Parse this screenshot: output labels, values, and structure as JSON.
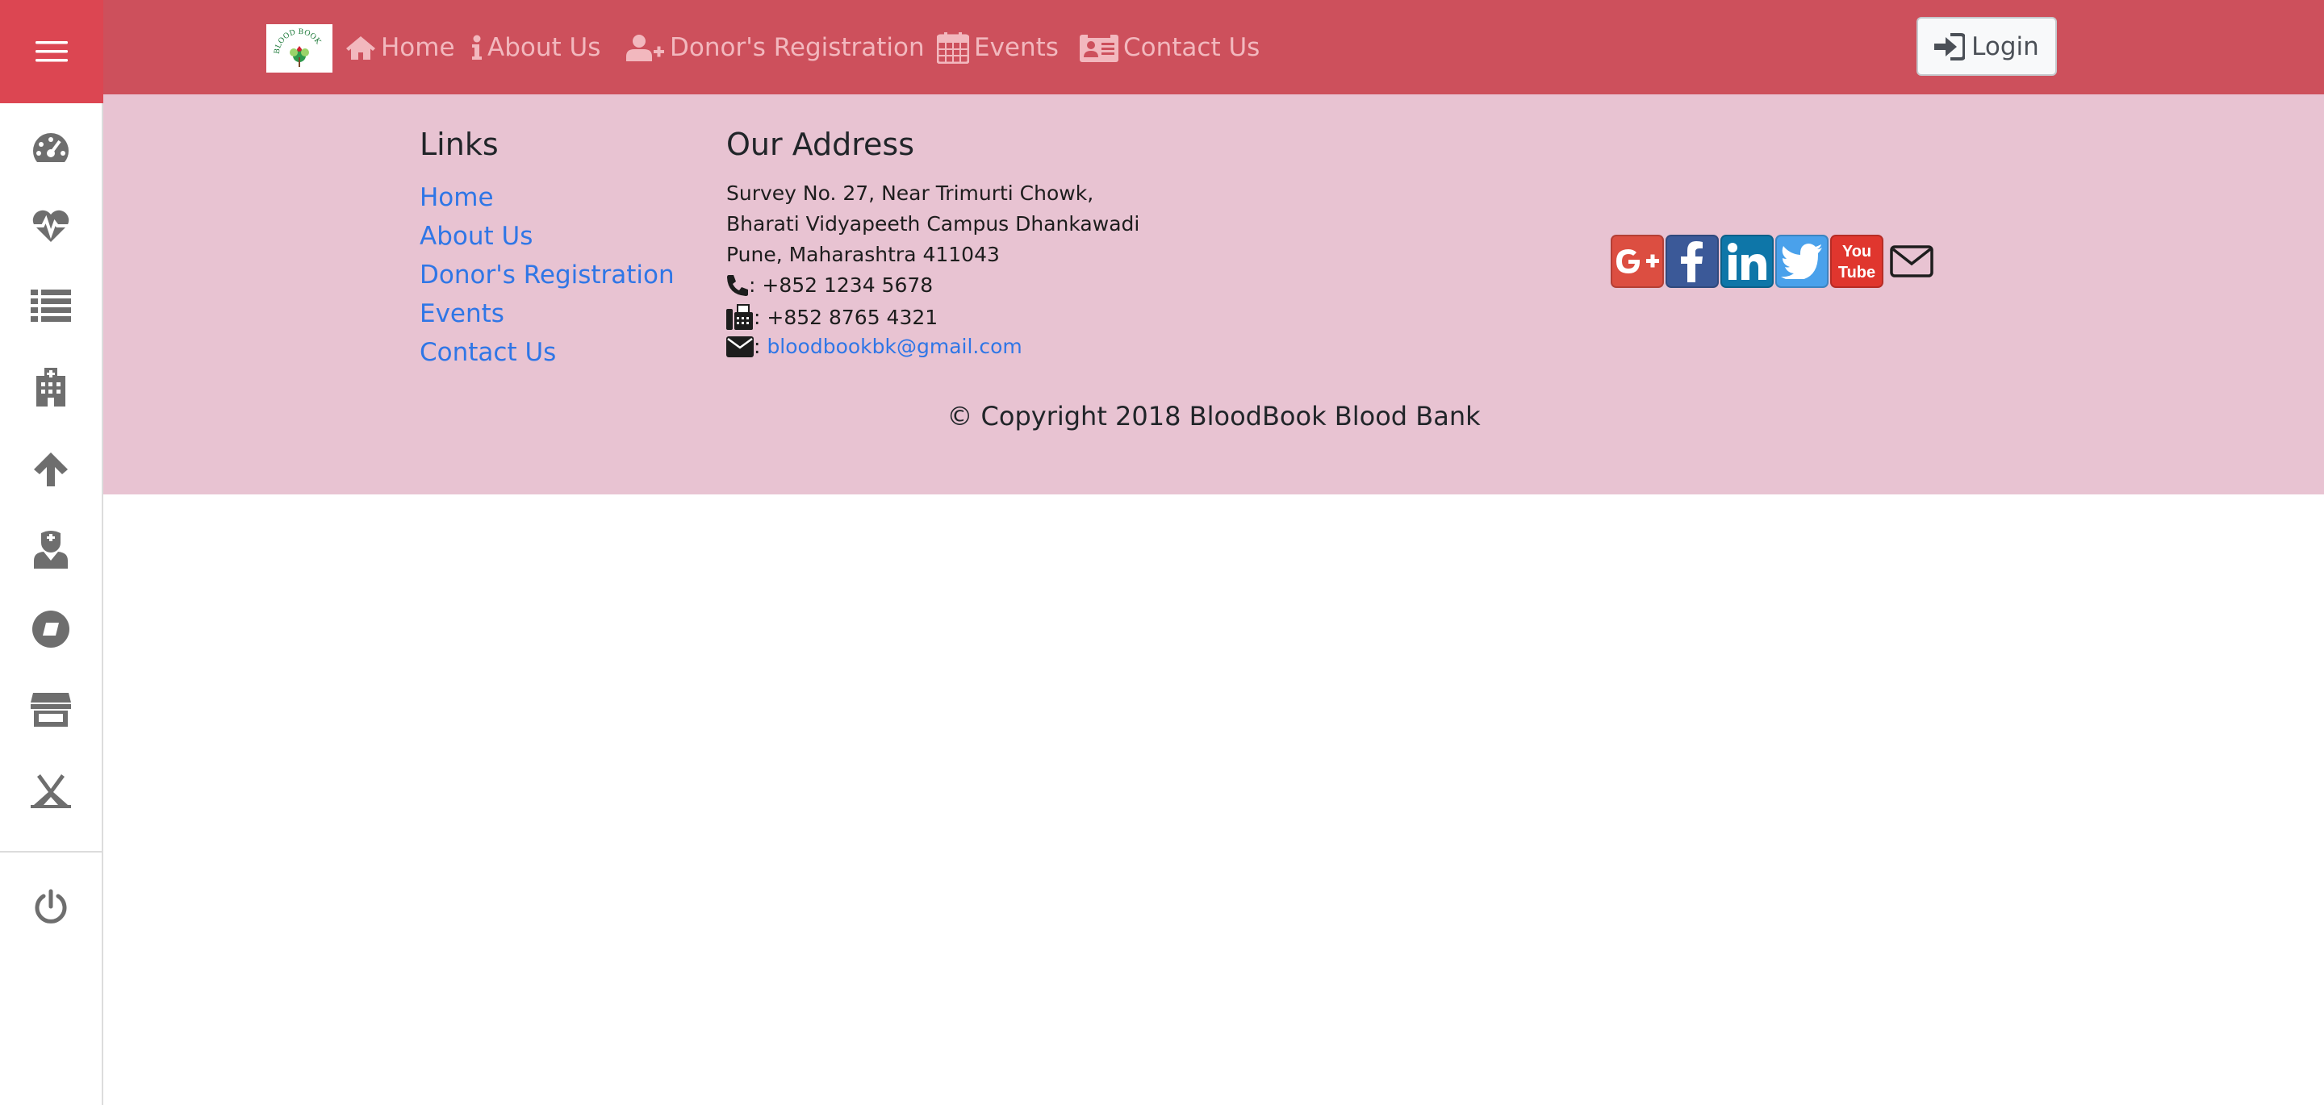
{
  "nav": {
    "logo_text": "BLOOD BOOK",
    "links": [
      {
        "label": "Home",
        "icon": "home-icon"
      },
      {
        "label": "About Us",
        "icon": "info-icon"
      },
      {
        "label": "Donor's Registration",
        "icon": "user-plus-icon"
      },
      {
        "label": "Events",
        "icon": "calendar-icon"
      },
      {
        "label": "Contact Us",
        "icon": "contact-card-icon"
      }
    ],
    "login_label": "Login"
  },
  "sidebar": {
    "items": [
      "dashboard-gauge-icon",
      "heartbeat-icon",
      "list-icon",
      "hospital-icon",
      "arrow-up-icon",
      "doctor-icon",
      "compass-icon",
      "store-icon",
      "campground-icon",
      "power-icon"
    ]
  },
  "footer": {
    "links_title": "Links",
    "links": [
      "Home",
      "About Us",
      "Donor's Registration",
      "Events",
      "Contact Us"
    ],
    "address_title": "Our Address",
    "address_lines": [
      "Survey No. 27, Near Trimurti Chowk,",
      "Bharati Vidyapeeth Campus Dhankawadi",
      "Pune, Maharashtra 411043"
    ],
    "phone": ": +852 1234 5678",
    "fax": ": +852 8765 4321",
    "email_prefix": ":",
    "email": "bloodbookbk@gmail.com",
    "social": [
      {
        "name": "google-plus-icon",
        "color": "#dc4e41"
      },
      {
        "name": "facebook-icon",
        "color": "#3b5998"
      },
      {
        "name": "linkedin-icon",
        "color": "#0e76a8"
      },
      {
        "name": "twitter-icon",
        "color": "#4aa1eb"
      },
      {
        "name": "youtube-icon",
        "color": "#e0362e"
      },
      {
        "name": "mail-icon",
        "color": "#1d1d1d"
      }
    ],
    "copyright": "© Copyright 2018 BloodBook Blood Bank"
  },
  "colors": {
    "nav_bg": "#cd505c",
    "toggle_bg": "#dc4652",
    "footer_bg": "#e8c3d2",
    "link": "#2f76e6",
    "nav_text": "#f2b8be"
  }
}
